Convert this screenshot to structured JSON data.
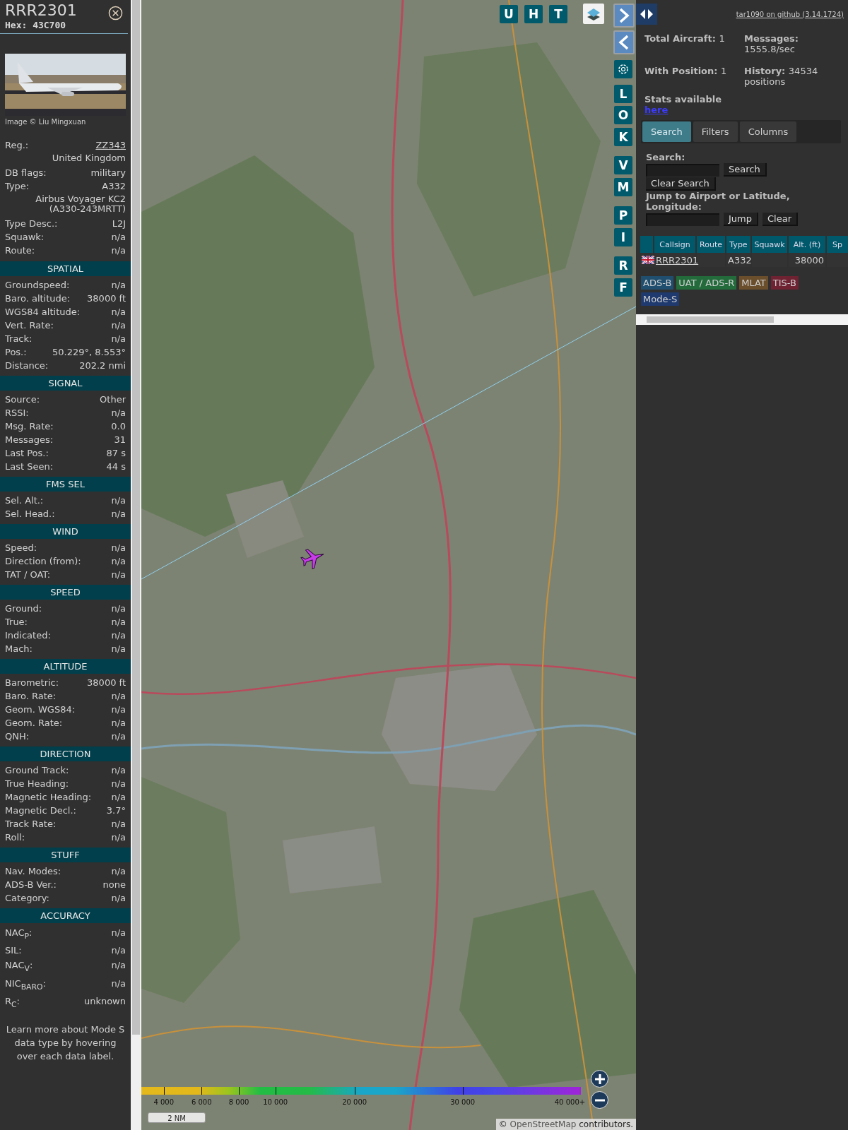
{
  "aircraft_panel": {
    "callsign": "RRR2301",
    "hex": "Hex: 43C700",
    "photo_credit": "Image © Liu Mingxuan",
    "details": [
      {
        "kind": "link",
        "label": "Reg.:",
        "value": "ZZ343"
      },
      {
        "kind": "note",
        "value": "United Kingdom"
      },
      {
        "kind": "pair",
        "label": "DB flags:",
        "value": "military"
      },
      {
        "kind": "pair",
        "label": "Type:",
        "value": "A332"
      },
      {
        "kind": "note",
        "value": "Airbus Voyager KC2 (A330-243MRTT)"
      },
      {
        "kind": "pair",
        "label": "Type Desc.:",
        "value": "L2J"
      },
      {
        "kind": "pair",
        "label": "Squawk:",
        "value": "n/a"
      },
      {
        "kind": "pair",
        "label": "Route:",
        "value": "n/a"
      }
    ],
    "sections": [
      {
        "title": "SPATIAL",
        "rows": [
          {
            "label": "Groundspeed:",
            "value": "n/a"
          },
          {
            "label": "Baro. altitude:",
            "value": "38000 ft"
          },
          {
            "label": "WGS84 altitude:",
            "value": "n/a"
          },
          {
            "label": "Vert. Rate:",
            "value": "n/a"
          },
          {
            "label": "Track:",
            "value": "n/a"
          },
          {
            "label": "Pos.:",
            "value": "50.229°, 8.553°"
          },
          {
            "label": "Distance:",
            "value": "202.2 nmi"
          }
        ]
      },
      {
        "title": "SIGNAL",
        "rows": [
          {
            "label": "Source:",
            "value": "Other"
          },
          {
            "label": "RSSI:",
            "value": "n/a"
          },
          {
            "label": "Msg. Rate:",
            "value": "0.0"
          },
          {
            "label": "Messages:",
            "value": "31"
          },
          {
            "label": "Last Pos.:",
            "value": "87 s"
          },
          {
            "label": "Last Seen:",
            "value": "44 s"
          }
        ]
      },
      {
        "title": "FMS SEL",
        "rows": [
          {
            "label": "Sel. Alt.:",
            "value": "n/a"
          },
          {
            "label": "Sel. Head.:",
            "value": "n/a"
          }
        ]
      },
      {
        "title": "WIND",
        "rows": [
          {
            "label": "Speed:",
            "value": "n/a"
          },
          {
            "label": "Direction (from):",
            "value": "n/a"
          },
          {
            "label": "TAT / OAT:",
            "value": "n/a"
          }
        ]
      },
      {
        "title": "SPEED",
        "rows": [
          {
            "label": "Ground:",
            "value": "n/a"
          },
          {
            "label": "True:",
            "value": "n/a"
          },
          {
            "label": "Indicated:",
            "value": "n/a"
          },
          {
            "label": "Mach:",
            "value": "n/a"
          }
        ]
      },
      {
        "title": "ALTITUDE",
        "rows": [
          {
            "label": "Barometric:",
            "value": "38000 ft"
          },
          {
            "label": "Baro. Rate:",
            "value": "n/a"
          },
          {
            "label": "Geom. WGS84:",
            "value": "n/a"
          },
          {
            "label": "Geom. Rate:",
            "value": "n/a"
          },
          {
            "label": "QNH:",
            "value": "n/a"
          }
        ]
      },
      {
        "title": "DIRECTION",
        "rows": [
          {
            "label": "Ground Track:",
            "value": "n/a"
          },
          {
            "label": "True Heading:",
            "value": "n/a"
          },
          {
            "label": "Magnetic Heading:",
            "value": "n/a"
          },
          {
            "label": "Magnetic Decl.:",
            "value": "3.7°"
          },
          {
            "label": "Track Rate:",
            "value": "n/a"
          },
          {
            "label": "Roll:",
            "value": "n/a"
          }
        ]
      },
      {
        "title": "STUFF",
        "rows": [
          {
            "label": "Nav. Modes:",
            "value": "n/a"
          },
          {
            "label": "ADS-B Ver.:",
            "value": "none"
          },
          {
            "label": "Category:",
            "value": "n/a"
          }
        ]
      },
      {
        "title": "ACCURACY",
        "rows": [
          {
            "label": "NAC$_{P}$:",
            "value": "n/a"
          },
          {
            "label": "SIL:",
            "value": "n/a"
          },
          {
            "label": "NAC$_{V}$:",
            "value": "n/a"
          },
          {
            "label": "NIC$_{BARO}$:",
            "value": "n/a"
          },
          {
            "label": "R$_{C}$:",
            "value": "unknown"
          }
        ]
      }
    ],
    "footer": "Learn more about Mode S data type by hovering over each data label."
  },
  "map": {
    "top_buttons": [
      "U",
      "H",
      "T"
    ],
    "side_button_groups": [
      [
        "L",
        "O",
        "K"
      ],
      [
        "V",
        "M"
      ],
      [
        "P",
        "I"
      ],
      [
        "R",
        "F"
      ]
    ],
    "altitude_legend": [
      "4 000",
      "6 000",
      "8 000",
      "10 000",
      "20 000",
      "30 000",
      "40 000+"
    ],
    "scale": "2 NM",
    "attribution": {
      "prefix": "©",
      "link": "OpenStreetMap",
      "suffix": "contributors."
    }
  },
  "list_panel": {
    "github_link": "tar1090 on github (3.14.1724)",
    "stats": [
      {
        "label": "Total Aircraft:",
        "value": "1"
      },
      {
        "label": "Messages:",
        "value": "1555.8/sec"
      },
      {
        "label": "With Position:",
        "value": "1"
      },
      {
        "label": "History:",
        "value": "34534 positions"
      }
    ],
    "stats_note": "Stats available",
    "stats_link": "here",
    "tabs": [
      {
        "label": "Search",
        "selected": true
      },
      {
        "label": "Filters",
        "selected": false
      },
      {
        "label": "Columns",
        "selected": false
      }
    ],
    "search_label": "Search:",
    "search_button": "Search",
    "clear_search_button": "Clear Search",
    "jump_label": "Jump to Airport or Latitude, Longitude:",
    "jump_button": "Jump",
    "clear_button": "Clear",
    "table": {
      "columns": [
        "Callsign",
        "Route",
        "Type",
        "Squawk",
        "Alt. (ft)",
        "Sp"
      ],
      "rows": [
        {
          "callsign": "RRR2301",
          "type": "A332",
          "altitude": "38000"
        }
      ]
    },
    "source_legend": [
      {
        "label": "ADS-B",
        "color": "#1f4e6e"
      },
      {
        "label": "UAT / ADS-R",
        "color": "#246b3c"
      },
      {
        "label": "MLAT",
        "color": "#6b4e2c"
      },
      {
        "label": "TIS-B",
        "color": "#6e2232"
      },
      {
        "label": "Mode-S",
        "color": "#1f3a6e"
      }
    ]
  }
}
